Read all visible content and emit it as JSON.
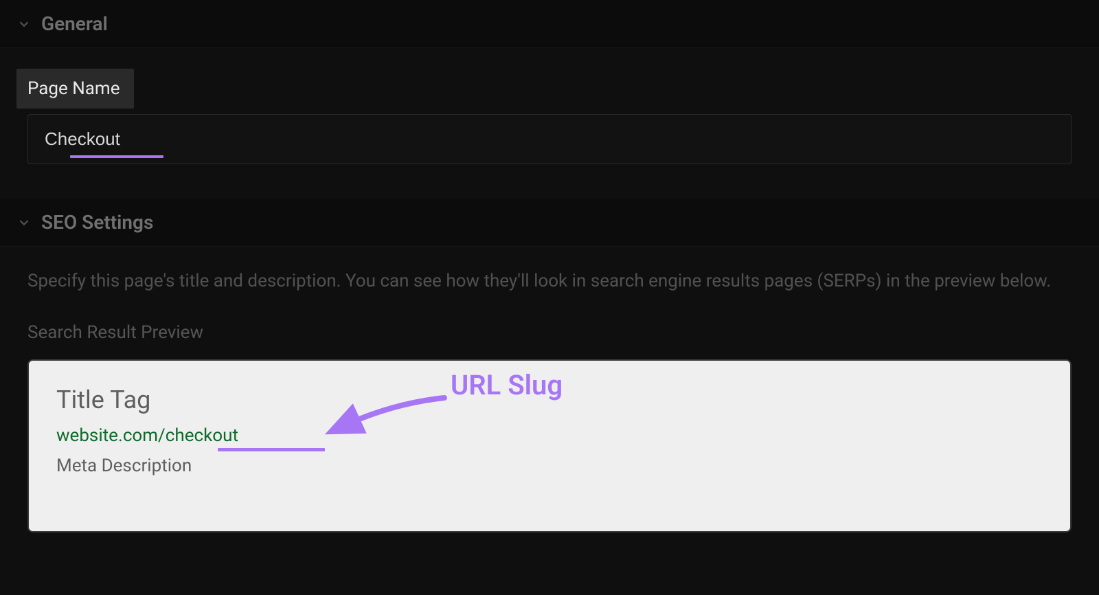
{
  "sections": {
    "general": {
      "title": "General",
      "page_name_label": "Page Name",
      "page_name_value": "Checkout"
    },
    "seo": {
      "title": "SEO Settings",
      "help_text": "Specify this page's title and description. You can see how they'll look in search engine results pages (SERPs) in the preview below.",
      "preview_label": "Search Result Preview",
      "preview": {
        "title_tag": "Title Tag",
        "url": "website.com/checkout",
        "meta_description": "Meta Description"
      }
    }
  },
  "annotation": {
    "label": "URL Slug"
  }
}
